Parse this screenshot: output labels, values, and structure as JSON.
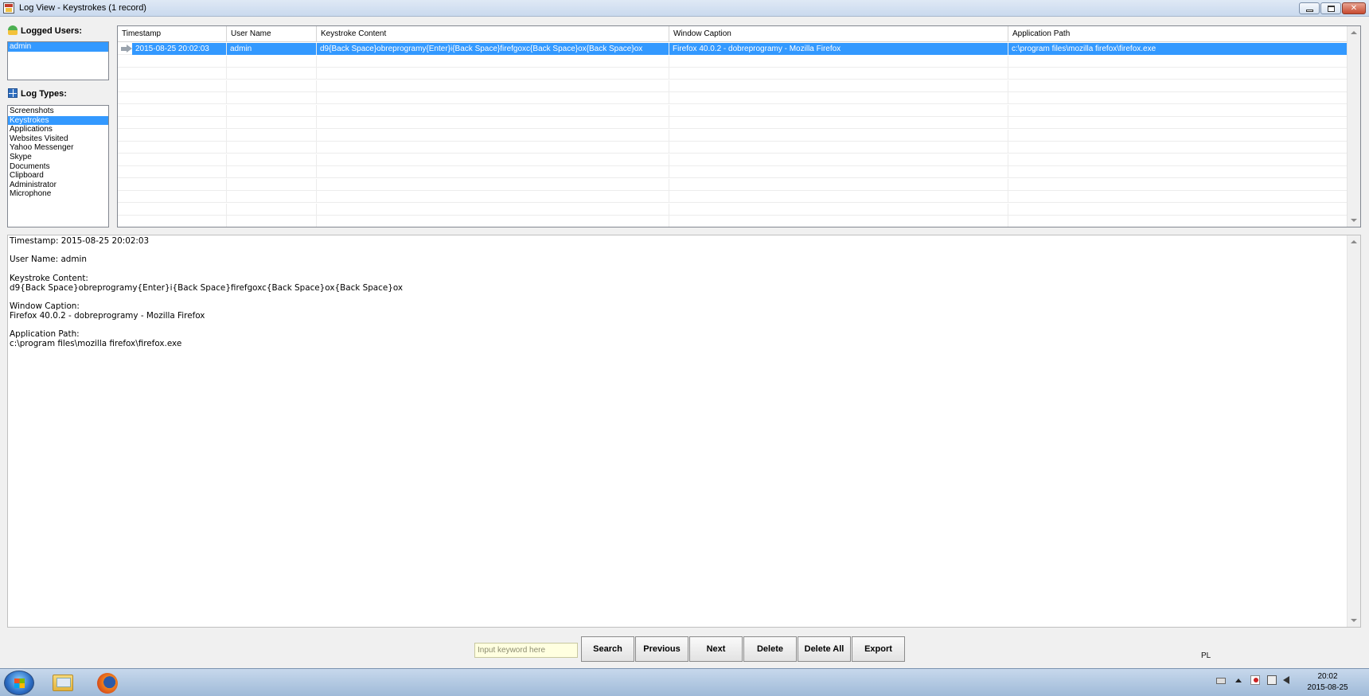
{
  "window": {
    "title": "Log View - Keystrokes (1 record)"
  },
  "sidebar": {
    "users_title": "Logged Users:",
    "users": [
      "admin"
    ],
    "selected_user": "admin",
    "types_title": "Log Types:",
    "types": [
      "Screenshots",
      "Keystrokes",
      "Applications",
      "Websites Visited",
      "Yahoo Messenger",
      "Skype",
      "Documents",
      "Clipboard",
      "Administrator",
      "Microphone"
    ],
    "selected_type": "Keystrokes"
  },
  "grid": {
    "columns": [
      "Timestamp",
      "User Name",
      "Keystroke Content",
      "Window Caption",
      "Application Path"
    ],
    "rows": [
      {
        "timestamp": "2015-08-25 20:02:03",
        "user": "admin",
        "content": "d9{Back Space}obreprogramy{Enter}i{Back Space}firefgoxc{Back Space}ox{Back Space}ox",
        "caption": "Firefox 40.0.2 - dobreprogramy - Mozilla Firefox",
        "path": "c:\\program files\\mozilla firefox\\firefox.exe"
      }
    ]
  },
  "details": {
    "text": "Timestamp: 2015-08-25 20:02:03\n\nUser Name: admin\n\nKeystroke Content:\nd9{Back Space}obreprogramy{Enter}i{Back Space}firefgoxc{Back Space}ox{Back Space}ox\n\nWindow Caption:\nFirefox 40.0.2 - dobreprogramy - Mozilla Firefox\n\nApplication Path:\nc:\\program files\\mozilla firefox\\firefox.exe"
  },
  "toolbar": {
    "search_placeholder": "Input keyword here",
    "search_value": "",
    "search_label": "Search",
    "previous_label": "Previous",
    "next_label": "Next",
    "delete_label": "Delete",
    "delete_all_label": "Delete All",
    "export_label": "Export"
  },
  "taskbar": {
    "language": "PL",
    "time": "20:02",
    "date": "2015-08-25",
    "apps": [
      "windows-explorer-icon",
      "firefox-icon"
    ]
  },
  "colors": {
    "selection": "#3399ff",
    "titlebar": "#c9d9ee",
    "search_field": "#ffffe0"
  }
}
